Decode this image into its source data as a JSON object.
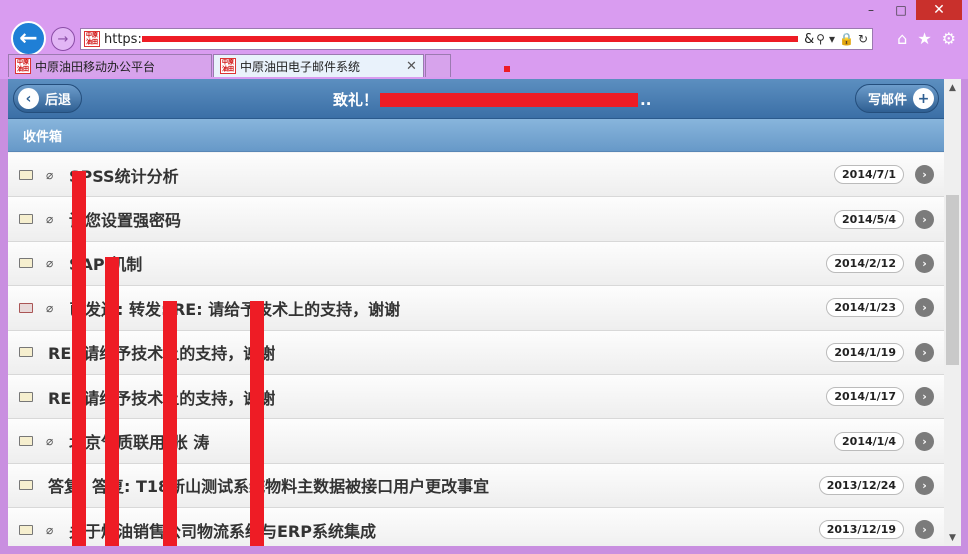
{
  "browser": {
    "url_prefix": "https:",
    "url_suffix": "&",
    "tabs": [
      {
        "label": "中原油田移动办公平台"
      },
      {
        "label": "中原油田电子邮件系统",
        "close": "✕"
      }
    ],
    "favicon_text": "中原油田",
    "window": {
      "minimize": "–",
      "maximize": "□",
      "close": "✕"
    }
  },
  "header": {
    "back_label": "后退",
    "compose_label": "写邮件",
    "title_start": "致礼！",
    "title_end": ".."
  },
  "folder": {
    "title": "收件箱"
  },
  "messages": [
    {
      "subject": "SPSS统计分析",
      "date": "2014/7/1",
      "attachment": true,
      "forwarded": false
    },
    {
      "subject": "请您设置强密码",
      "date": "2014/5/4",
      "attachment": true,
      "forwarded": false
    },
    {
      "subject": "SAP 机制",
      "date": "2014/2/12",
      "attachment": true,
      "forwarded": false
    },
    {
      "subject": "已发送: 转发: RE: 请给予技术上的支持，谢谢",
      "date": "2014/1/23",
      "attachment": true,
      "forwarded": true
    },
    {
      "subject": "RE: 请给予技术上的支持，谢谢",
      "date": "2014/1/19",
      "attachment": false,
      "forwarded": false
    },
    {
      "subject": "RE: 请给予技术上的支持，谢谢",
      "date": "2014/1/17",
      "attachment": false,
      "forwarded": false
    },
    {
      "subject": "北京气质联用-张 涛",
      "date": "2014/1/4",
      "attachment": true,
      "forwarded": false
    },
    {
      "subject": "答复: 答复: T18新山测试系统物料主数据被接口用户更改事宜",
      "date": "2013/12/24",
      "attachment": false,
      "forwarded": false
    },
    {
      "subject": "关于炼油销售公司物流系统与ERP系统集成",
      "date": "2013/12/19",
      "attachment": true,
      "forwarded": false
    }
  ]
}
